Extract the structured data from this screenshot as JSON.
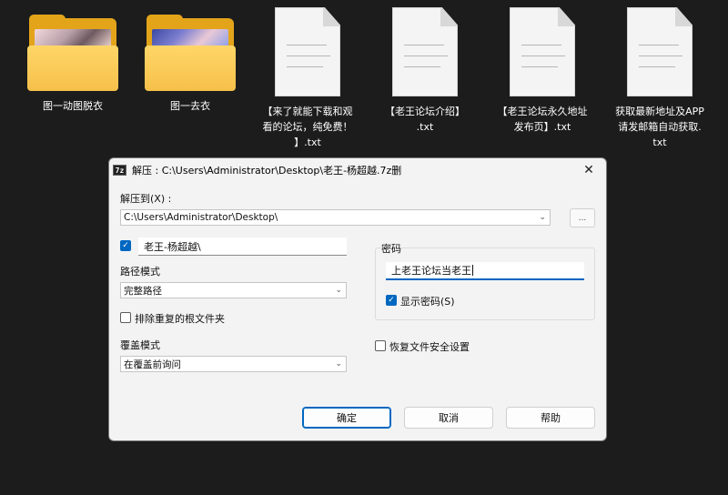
{
  "desktop": {
    "items": [
      {
        "label": "图一动图脱衣",
        "icon": "folder-icon"
      },
      {
        "label": "图一去衣",
        "icon": "folder-icon"
      },
      {
        "label": "【来了就能下载和观\n看的论坛，纯免费！\n】.txt",
        "icon": "text-file-icon"
      },
      {
        "label": "【老王论坛介绍】\n.txt",
        "icon": "text-file-icon"
      },
      {
        "label": "【老王论坛永久地址\n发布页】.txt",
        "icon": "text-file-icon"
      },
      {
        "label": "获取最新地址及APP\n请发邮箱自动获取.\ntxt",
        "icon": "text-file-icon"
      }
    ]
  },
  "dialog": {
    "app_icon_text": "7z",
    "title": "解压 : C:\\Users\\Administrator\\Desktop\\老王-杨超越.7z删",
    "close_glyph": "✕",
    "extract_to_label": "解压到(X) :",
    "extract_to_value": "C:\\Users\\Administrator\\Desktop\\",
    "browse_label": "...",
    "subfolder_checked": true,
    "subfolder_value": "老王-杨超越\\",
    "path_mode_label": "路径模式",
    "path_mode_value": "完整路径",
    "eliminate_root_label": "排除重复的根文件夹",
    "eliminate_root_checked": false,
    "overwrite_mode_label": "覆盖模式",
    "overwrite_mode_value": "在覆盖前询问",
    "password_label": "密码",
    "password_value": "上老王论坛当老王",
    "show_password_label": "显示密码(S)",
    "show_password_checked": true,
    "restore_security_label": "恢复文件安全设置",
    "restore_security_checked": false,
    "ok_label": "确定",
    "cancel_label": "取消",
    "help_label": "帮助"
  },
  "colors": {
    "accent": "#0067c0",
    "folder": "#f6c04a",
    "desktop_bg": "#1c1c1c"
  }
}
